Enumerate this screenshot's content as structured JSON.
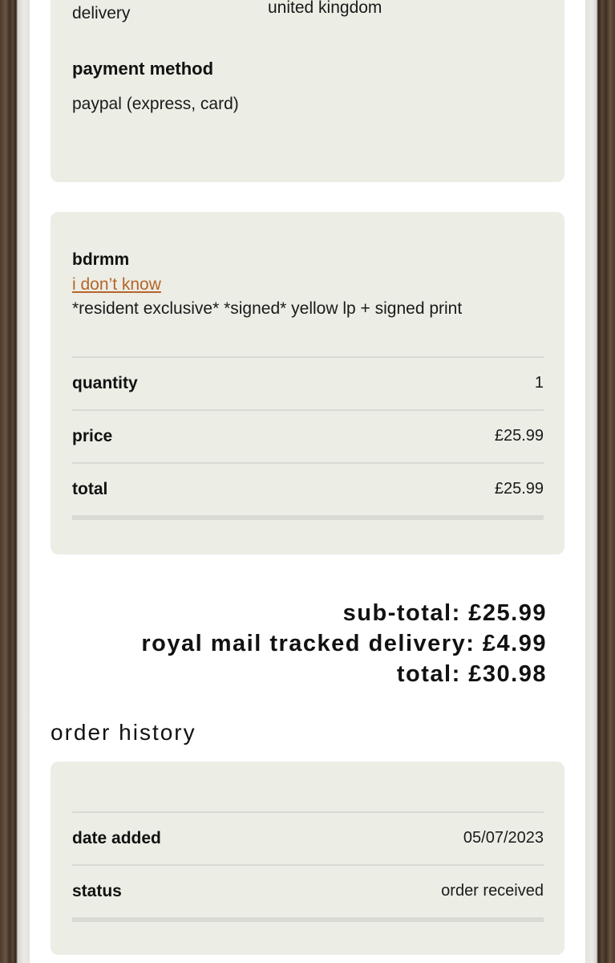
{
  "shipping": {
    "method": "royal mail tracked delivery",
    "country": "united kingdom"
  },
  "payment": {
    "title": "payment method",
    "value": "paypal (express, card)"
  },
  "product": {
    "artist": "bdrmm",
    "album": "i don’t know",
    "description": "*resident exclusive* *signed* yellow lp + signed print",
    "rows": [
      {
        "label": "quantity",
        "value": "1"
      },
      {
        "label": "price",
        "value": "£25.99"
      },
      {
        "label": "total",
        "value": "£25.99"
      }
    ]
  },
  "totals": {
    "subtotal": "sub-total: £25.99",
    "delivery": "royal mail tracked delivery: £4.99",
    "total": "total: £30.98"
  },
  "history": {
    "title": "order history",
    "rows": [
      {
        "label": "date added",
        "value": "05/07/2023"
      },
      {
        "label": "status",
        "value": "order received"
      }
    ]
  },
  "colors": {
    "panel": "#ecede5",
    "link": "#b5652a",
    "divider": "#d9dad3"
  }
}
